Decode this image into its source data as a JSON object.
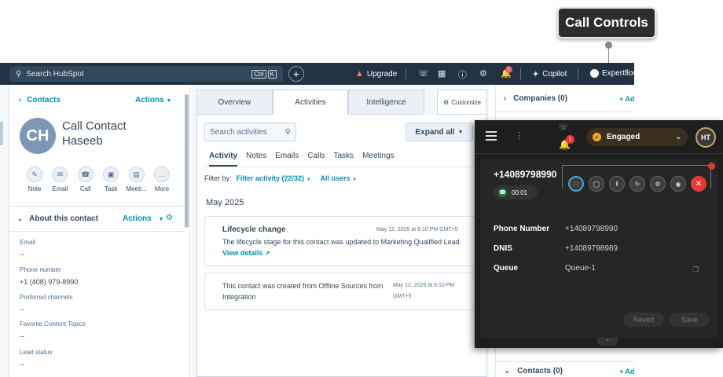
{
  "callout": {
    "label": "Call Controls"
  },
  "topnav": {
    "search_placeholder": "Search HubSpot",
    "shortcut_ctrl": "Ctrl",
    "shortcut_k": "K",
    "plus": "+",
    "upgrade": "Upgrade",
    "notifications_count": "1",
    "copilot": "Copilot",
    "account": "Expertflow"
  },
  "contact": {
    "back_label": "Contacts",
    "actions_label": "Actions",
    "initials": "CH",
    "name_line1": "Call Contact",
    "name_line2": "Haseeb",
    "quick_actions": [
      "Note",
      "Email",
      "Call",
      "Task",
      "Meeti...",
      "More"
    ],
    "about_title": "About this contact",
    "about_actions": "Actions",
    "properties": [
      {
        "label": "Email",
        "value": "--"
      },
      {
        "label": "Phone number",
        "value": "+1 (408) 979-8990"
      },
      {
        "label": "Preferred channels",
        "value": "--"
      },
      {
        "label": "Favorite Content Topics",
        "value": "--"
      },
      {
        "label": "Lead status",
        "value": "--"
      }
    ]
  },
  "middle": {
    "tabs": [
      "Overview",
      "Activities",
      "Intelligence"
    ],
    "customize": "Customize",
    "search_placeholder": "Search activities",
    "expand_all": "Expand all",
    "subtabs": [
      "Activity",
      "Notes",
      "Emails",
      "Calls",
      "Tasks",
      "Meetings"
    ],
    "filter_by": "Filter by:",
    "filter_activity": "Filter activity (22/32)",
    "all_users": "All users",
    "month": "May 2025",
    "card1": {
      "title": "Lifecycle change",
      "date": "May 12, 2025 at 6:10 PM GMT+5",
      "text": "The lifecycle stage for this contact was updated to Marketing Qualified Lead.",
      "link": "View details"
    },
    "card2": {
      "text": "This contact was created from Offline Sources from Integration",
      "date_line1": "May 12, 2025 at 6:10 PM",
      "date_line2": "GMT+5"
    }
  },
  "right": {
    "companies": "Companies (0)",
    "contacts": "Contacts (0)",
    "add": "+ Ad"
  },
  "widget": {
    "notification_count": "1",
    "status": "Engaged",
    "agent_initials": "HT",
    "caller_number": "+14089798990",
    "timer": "00:01",
    "fields": [
      {
        "label": "Phone Number",
        "value": "+14089798990"
      },
      {
        "label": "DNIS",
        "value": "+14089798989"
      },
      {
        "label": "Queue",
        "value": "Queue-1"
      }
    ],
    "revert": "Revert",
    "save": "Save"
  }
}
